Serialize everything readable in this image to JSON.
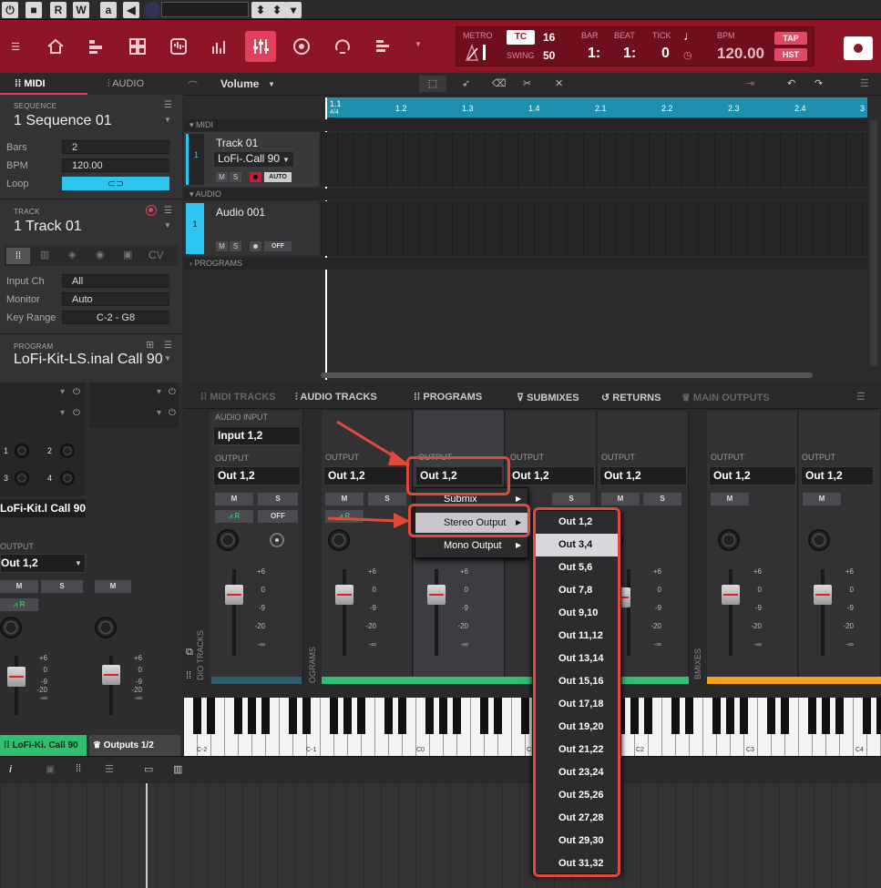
{
  "transport": {
    "record": "R",
    "write": "W",
    "automation": "a"
  },
  "header": {
    "metro_label": "METRO",
    "tc_label": "TC",
    "tc_value": "16",
    "swing_label": "SWING",
    "swing_value": "50",
    "bar_label": "BAR",
    "beat_label": "BEAT",
    "tick_label": "TICK",
    "bar_value": "1:",
    "beat_value": "1:",
    "tick_value": "0",
    "bpm_label": "BPM",
    "bpm_value": "120.00",
    "tap_label": "TAP",
    "hst_label": "HST"
  },
  "left": {
    "tab_midi": "MIDI",
    "tab_audio": "AUDIO",
    "sequence_label": "SEQUENCE",
    "sequence_value": "1 Sequence 01",
    "bars_label": "Bars",
    "bars_value": "2",
    "bpm_label": "BPM",
    "bpm_value": "120.00",
    "loop_label": "Loop",
    "track_label": "TRACK",
    "track_value": "1 Track 01",
    "cv_label": "CV",
    "input_ch_label": "Input Ch",
    "input_ch_value": "All",
    "monitor_label": "Monitor",
    "monitor_value": "Auto",
    "key_range_label": "Key Range",
    "key_range_value": "C-2 - G8",
    "program_label": "PROGRAM",
    "program_value": "LoFi-Kit-LS.inal Call 90"
  },
  "arrange": {
    "view_select": "Volume",
    "ruler": [
      "1.1",
      "1.2",
      "1.3",
      "1.4",
      "2.1",
      "2.2",
      "2.3",
      "2.4",
      "3"
    ],
    "ruler_sub": "4/4",
    "midi_header": "MIDI",
    "audio_header": "AUDIO",
    "programs_header": "PROGRAMS",
    "track1_num": "1",
    "track1_name": "Track 01",
    "track1_program": "LoFi-.Call 90",
    "track1_auto": "AUTO",
    "audio1_num": "1",
    "audio1_name": "Audio 001",
    "audio1_off": "OFF",
    "m": "M",
    "s": "S"
  },
  "mixer": {
    "tabs": [
      "MIDI TRACKS",
      "AUDIO TRACKS",
      "PROGRAMS",
      "SUBMIXES",
      "RETURNS",
      "MAIN OUTPUTS"
    ],
    "audio_input_label": "AUDIO INPUT",
    "audio_input_value": "Input 1,2",
    "output_label": "OUTPUT",
    "output_value": "Out 1,2",
    "m": "M",
    "s": "S",
    "r": "R",
    "off": "OFF",
    "scale": [
      "+6",
      "0",
      "-9",
      "-20",
      "-∞"
    ],
    "side_tracks": "DIO TRACKS",
    "side_programs": "OGRAMS",
    "side_submixes": "BMIXES"
  },
  "lowleft": {
    "program_name": "LoFi-Kit.l Call 90",
    "output_label": "OUTPUT",
    "output_value": "Out 1,2",
    "pad_nums": [
      "1",
      "2",
      "3",
      "4"
    ],
    "footer_left": "LoFi-Ki. Call 90",
    "footer_right": "Outputs 1/2"
  },
  "context_menu": {
    "items": [
      "Submix",
      "Stereo Output",
      "Mono Output"
    ]
  },
  "submenu": {
    "items": [
      "Out 1,2",
      "Out 3,4",
      "Out 5,6",
      "Out 7,8",
      "Out 9,10",
      "Out 11,12",
      "Out 13,14",
      "Out 15,16",
      "Out 17,18",
      "Out 19,20",
      "Out 21,22",
      "Out 23,24",
      "Out 25,26",
      "Out 27,28",
      "Out 29,30",
      "Out 31,32"
    ]
  },
  "keyboard": {
    "labels": [
      "C-2",
      "C-1",
      "C0",
      "C1",
      "C2",
      "C3",
      "C4"
    ]
  },
  "colors": {
    "header_red": "#8e1528",
    "accent_cyan": "#2ec4f0",
    "ruler_blue": "#1f8fae",
    "green": "#2fbf71",
    "orange": "#f5a01e",
    "annotation_red": "#e04a3a"
  }
}
